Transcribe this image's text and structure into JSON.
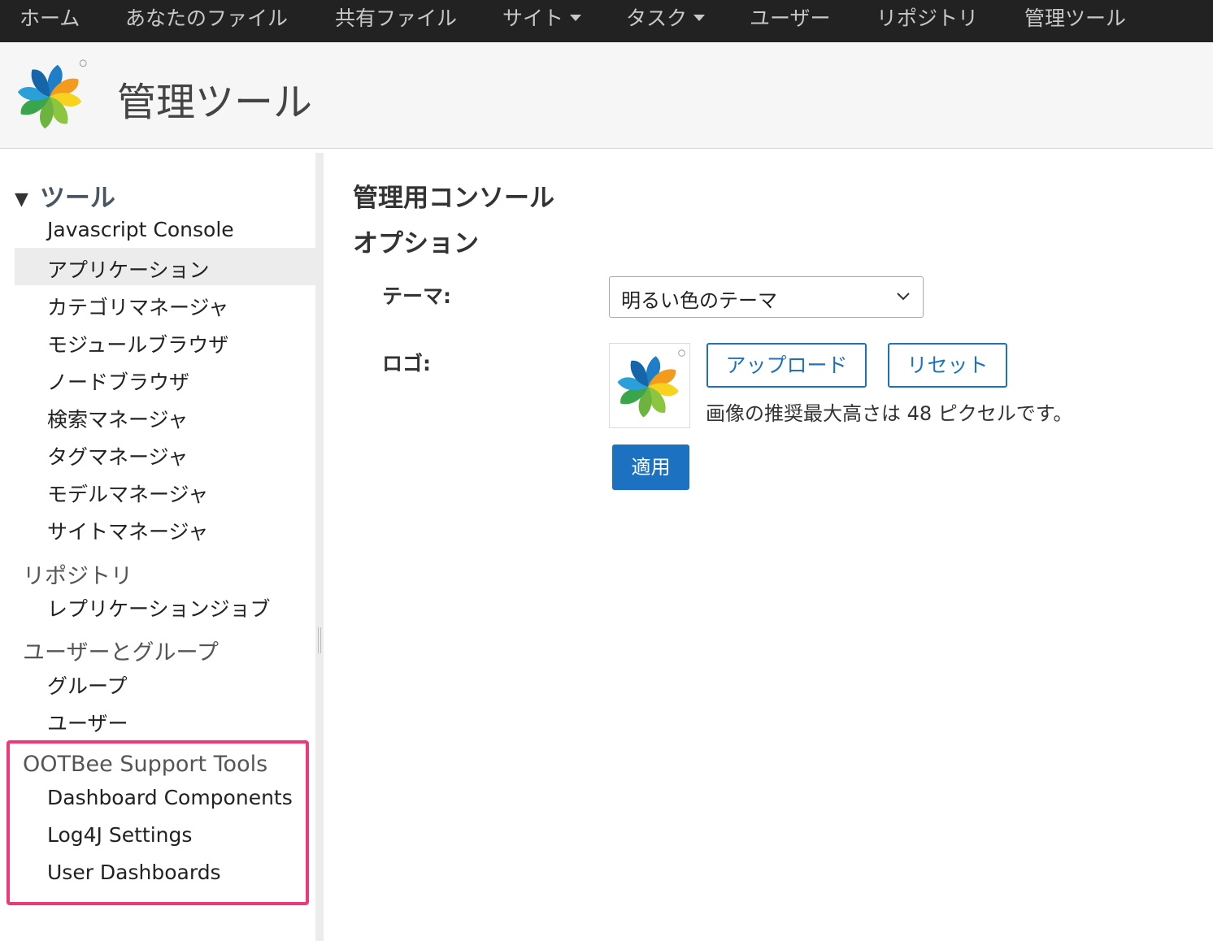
{
  "topnav": {
    "items": [
      {
        "label": "ホーム"
      },
      {
        "label": "あなたのファイル"
      },
      {
        "label": "共有ファイル"
      },
      {
        "label": "サイト"
      },
      {
        "label": "タスク"
      },
      {
        "label": "ユーザー"
      },
      {
        "label": "リポジトリ"
      },
      {
        "label": "管理ツール"
      }
    ]
  },
  "header": {
    "title": "管理ツール"
  },
  "sidebar": {
    "tools_heading": "ツール",
    "tools_items": [
      {
        "label": "Javascript Console"
      },
      {
        "label": "アプリケーション"
      },
      {
        "label": "カテゴリマネージャ"
      },
      {
        "label": "モジュールブラウザ"
      },
      {
        "label": "ノードブラウザ"
      },
      {
        "label": "検索マネージャ"
      },
      {
        "label": "タグマネージャ"
      },
      {
        "label": "モデルマネージャ"
      },
      {
        "label": "サイトマネージャ"
      }
    ],
    "repo_heading": "リポジトリ",
    "repo_items": [
      {
        "label": "レプリケーションジョブ"
      }
    ],
    "users_heading": "ユーザーとグループ",
    "users_items": [
      {
        "label": "グループ"
      },
      {
        "label": "ユーザー"
      }
    ],
    "ootbee_heading": "OOTBee Support Tools",
    "ootbee_items": [
      {
        "label": "Dashboard Components"
      },
      {
        "label": "Log4J Settings"
      },
      {
        "label": "User Dashboards"
      }
    ],
    "selected": "アプリケーション"
  },
  "main": {
    "title": "管理用コンソール",
    "section": "オプション",
    "theme_label": "テーマ:",
    "theme_value": "明るい色のテーマ",
    "logo_label": "ロゴ:",
    "upload_label": "アップロード",
    "reset_label": "リセット",
    "hint": "画像の推奨最大高さは 48 ピクセルです。",
    "apply_label": "適用"
  },
  "colors": {
    "nav_bg": "#222222",
    "accent": "#1c72c1",
    "highlight": "#f0377a"
  }
}
